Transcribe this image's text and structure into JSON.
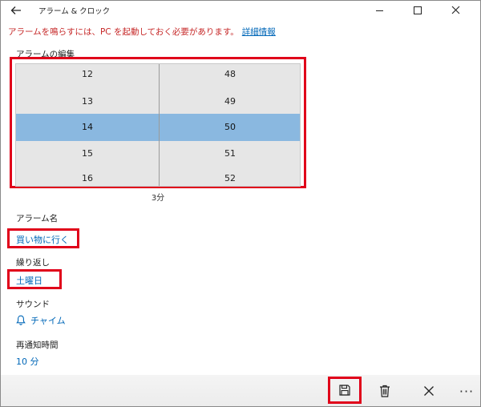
{
  "window": {
    "title": "アラーム & クロック",
    "back_icon": "back-arrow-icon",
    "controls": [
      "minimize-icon",
      "maximize-icon",
      "close-icon"
    ]
  },
  "warning": {
    "text": "アラームを鳴らすには、PC を起動しておく必要があります。",
    "link": "詳細情報"
  },
  "edit_section_title": "アラームの編集",
  "time_picker": {
    "hours": [
      "12",
      "13",
      "14",
      "15",
      "16"
    ],
    "minutes": [
      "48",
      "49",
      "50",
      "51",
      "52"
    ],
    "selected_hour": "14",
    "selected_minute": "50"
  },
  "duration_text": "3分",
  "alarm_name": {
    "label": "アラーム名",
    "value": "買い物に行く"
  },
  "repeat": {
    "label": "繰り返し",
    "value": "土曜日"
  },
  "sound": {
    "label": "サウンド",
    "value": "チャイム",
    "icon": "bell-icon"
  },
  "snooze": {
    "label": "再通知時間",
    "value": "10 分"
  },
  "commandbar": {
    "items": [
      "save-icon",
      "delete-icon",
      "cancel-icon",
      "more-icon"
    ],
    "more_glyph": "···"
  },
  "colors": {
    "accent": "#0067b8",
    "warning": "#c62828",
    "selected_row": "#8ab8e0",
    "highlight_box": "#e0001a"
  }
}
